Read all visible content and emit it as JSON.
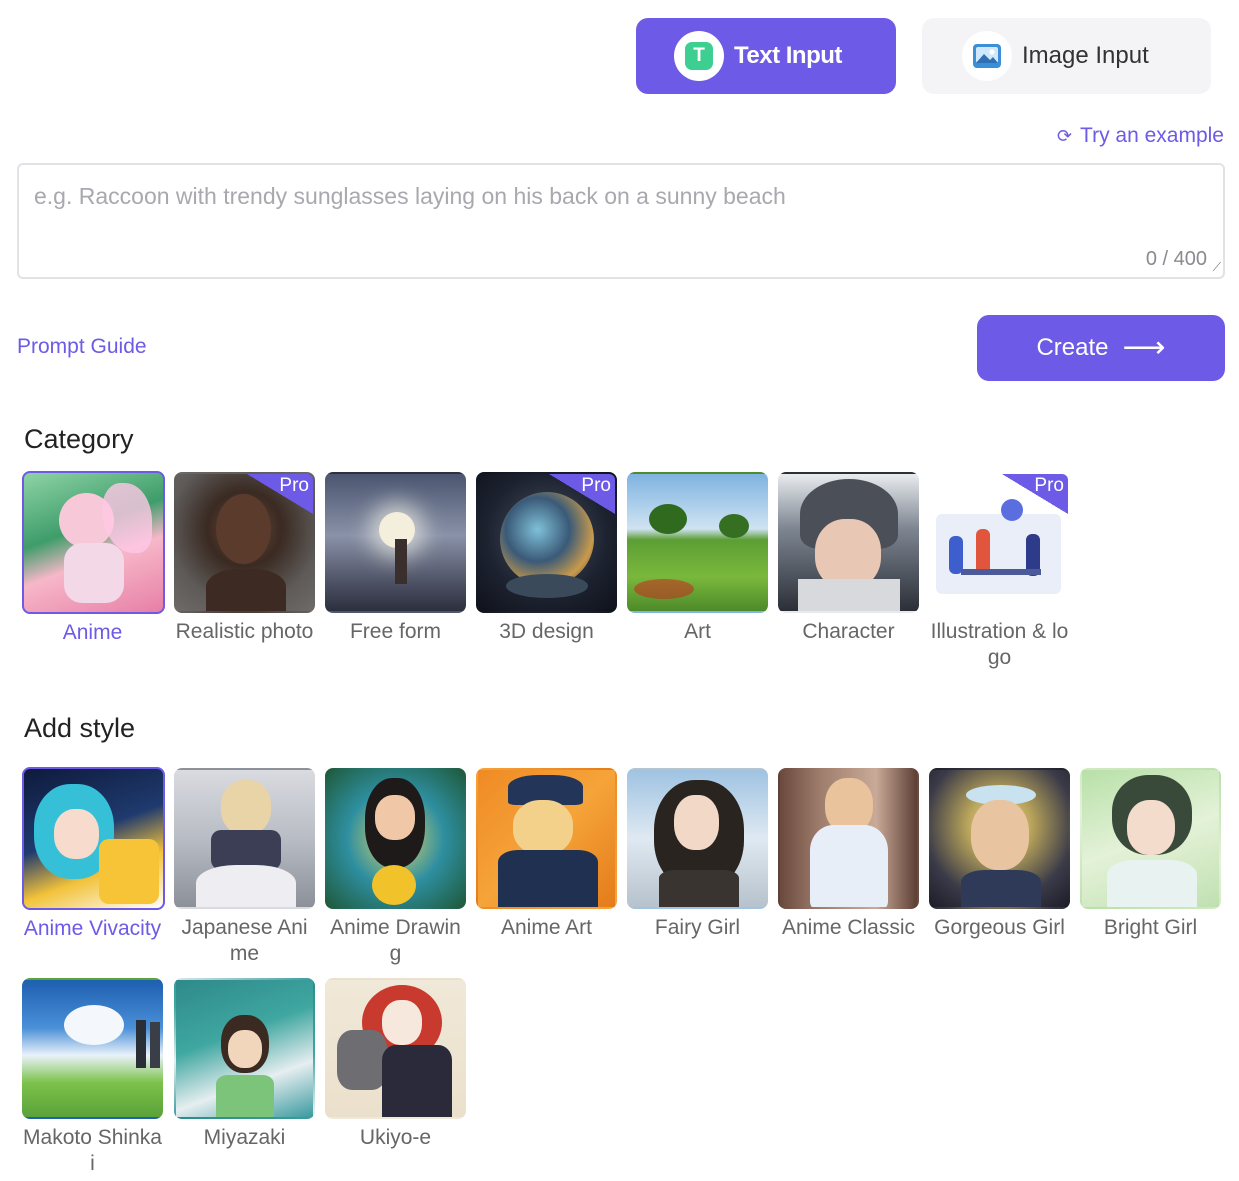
{
  "mode": {
    "text_input_label": "Text Input",
    "image_input_label": "Image Input"
  },
  "try_example": "Try an example",
  "prompt": {
    "placeholder": "e.g. Raccoon with trendy sunglasses laying on his back on a sunny beach",
    "value": "",
    "char_count": "0 / 400"
  },
  "prompt_guide": "Prompt Guide",
  "create_label": "Create",
  "pro_badge": "Pro",
  "category": {
    "title": "Category",
    "items": [
      {
        "label": "Anime",
        "selected": true,
        "pro": false
      },
      {
        "label": "Realistic photo",
        "selected": false,
        "pro": true
      },
      {
        "label": "Free form",
        "selected": false,
        "pro": false
      },
      {
        "label": "3D design",
        "selected": false,
        "pro": true
      },
      {
        "label": "Art",
        "selected": false,
        "pro": false
      },
      {
        "label": "Character",
        "selected": false,
        "pro": false
      },
      {
        "label": "Illustration & logo",
        "selected": false,
        "pro": true
      }
    ]
  },
  "style": {
    "title": "Add style",
    "items": [
      {
        "label": "Anime Vivacity",
        "selected": true
      },
      {
        "label": "Japanese Anime",
        "selected": false
      },
      {
        "label": "Anime Drawing",
        "selected": false
      },
      {
        "label": "Anime Art",
        "selected": false
      },
      {
        "label": "Fairy Girl",
        "selected": false
      },
      {
        "label": "Anime Classic",
        "selected": false
      },
      {
        "label": "Gorgeous Girl",
        "selected": false
      },
      {
        "label": "Bright Girl",
        "selected": false
      },
      {
        "label": "Makoto Shinkai",
        "selected": false
      },
      {
        "label": "Miyazaki",
        "selected": false
      },
      {
        "label": "Ukiyo-e",
        "selected": false
      }
    ]
  },
  "colors": {
    "accent": "#6d5ae6",
    "text_icon_bg": "#3ccf91"
  }
}
